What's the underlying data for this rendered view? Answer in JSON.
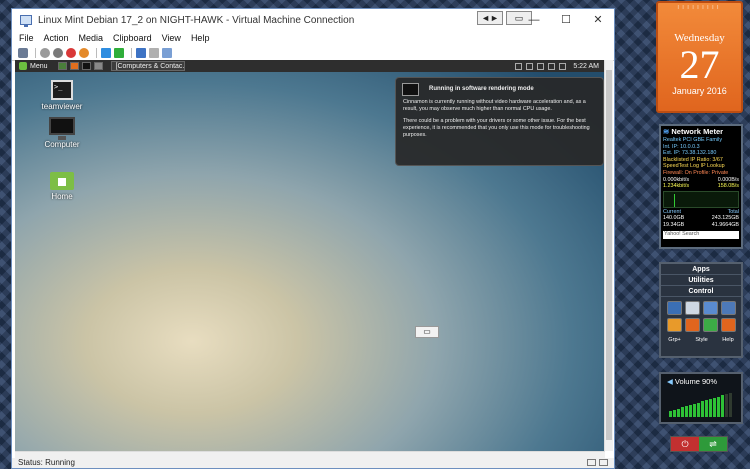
{
  "window": {
    "title": "Linux Mint Debian 17_2 on NIGHT-HAWK - Virtual Machine Connection",
    "center_controls": [
      "◄►",
      "▭"
    ],
    "minimize": "—",
    "maximize": "☐",
    "close": "✕"
  },
  "menu": [
    "File",
    "Action",
    "Media",
    "Clipboard",
    "View",
    "Help"
  ],
  "guest": {
    "panel": {
      "menu_label": "Menu",
      "task_label": "[Computers & Contac...",
      "clock": "5:22 AM"
    },
    "desktop_icons": [
      {
        "label": "teamviewer",
        "glyph": ">_"
      },
      {
        "label": "Computer"
      },
      {
        "label": "Home"
      }
    ],
    "notification": {
      "title": "Running in software rendering mode",
      "body1": "Cinnamon is currently running without video hardware acceleration and, as a result, you may observe much higher than normal CPU usage.",
      "body2": "There could be a problem with your drivers or some other issue.  For the best experience, it is recommended that you only use this mode for troubleshooting purposes."
    },
    "float_button": "▭"
  },
  "status": {
    "text": "Status: Running"
  },
  "calendar": {
    "weekday": "Wednesday",
    "day": "27",
    "month_year": "January 2016"
  },
  "network_meter": {
    "title": "Network Meter",
    "lines": [
      "Realtek PCI GBE Family",
      "Int. IP: 10.0.0.3",
      "Ext. IP: 73.38.132.180",
      "Blacklisted IP Ratio: 3/67",
      "SpeedTest   Log   IP Lookup",
      "Firewall: On    Profile: Private"
    ],
    "rate_up": "0.000kbit/s",
    "rate_up_b": "0.000B/s",
    "rate_down": "1.234kbit/s",
    "rate_down_b": "158.0B/s",
    "current_label": "Current",
    "total_label": "Total",
    "cur_up": "140.0GB",
    "tot_up": "243.125GB",
    "cur_down": "19.34GB",
    "tot_down": "41.9664GB",
    "search_placeholder": "Yahoo! Search"
  },
  "apps": {
    "tabs": [
      "Apps",
      "Utilities",
      "Control"
    ],
    "footer": [
      "Grp+",
      "Style",
      "Help"
    ]
  },
  "volume": {
    "label": "Volume 90%",
    "level": 0.9
  },
  "power": {
    "off": "⏻",
    "switch": "⇌"
  },
  "colors": {
    "accent_orange": "#e0651e",
    "accent_green": "#2ec236",
    "vm_border": "#6d8fbf"
  }
}
